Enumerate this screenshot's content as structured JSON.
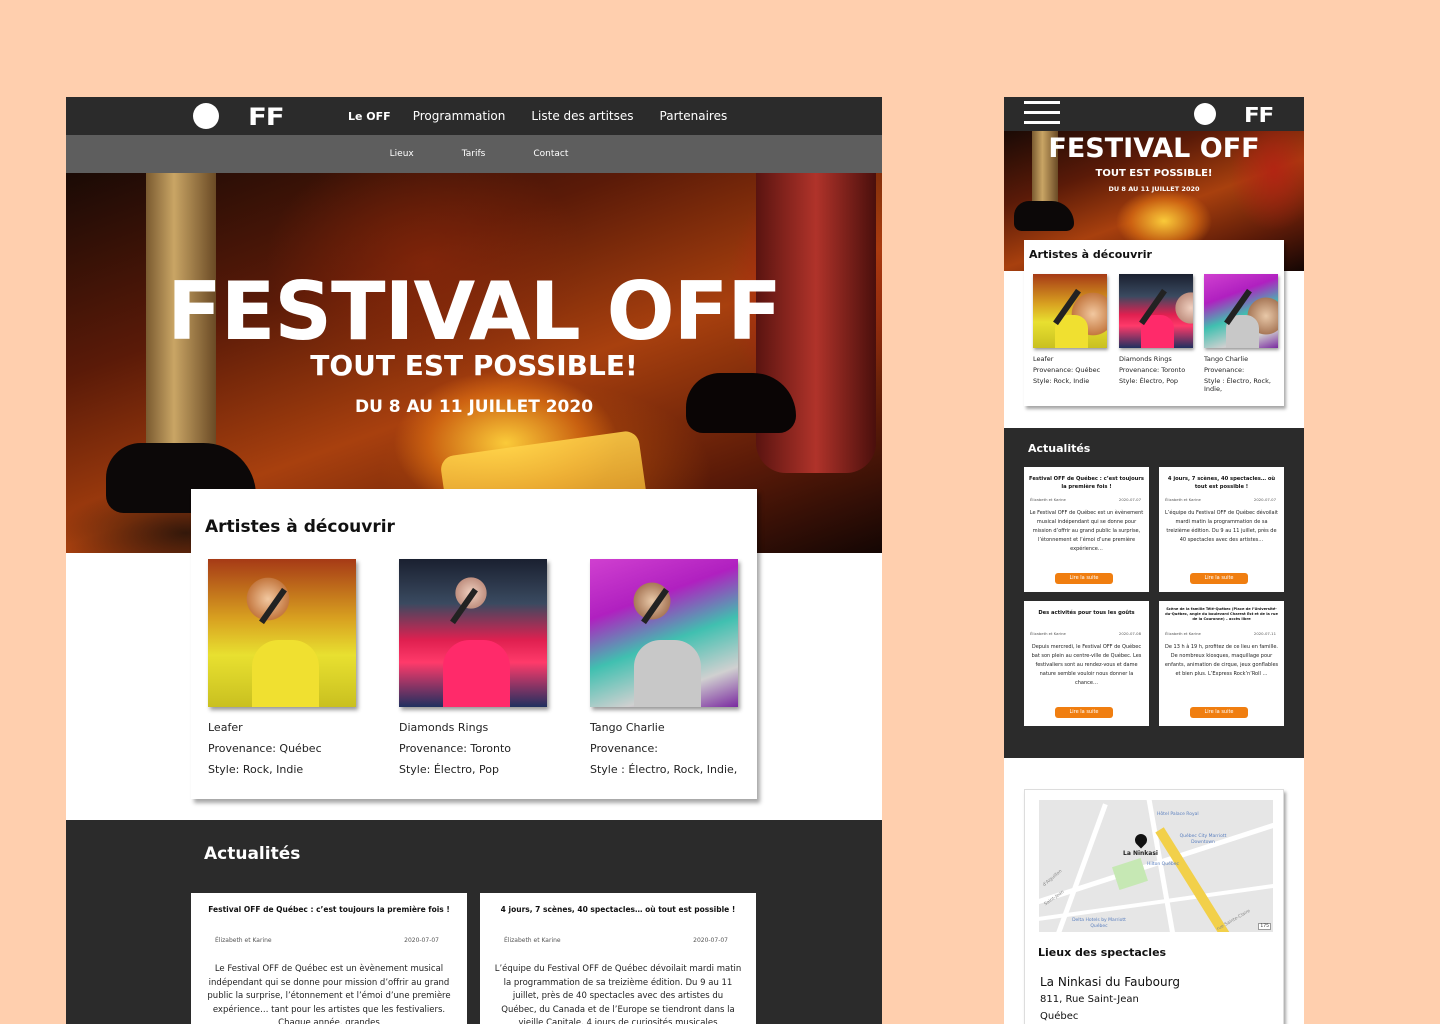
{
  "desktop": {
    "logo_text": "FF",
    "nav": {
      "items": [
        "Le OFF",
        "Programmation",
        "Liste des artitses",
        "Partenaires"
      ],
      "active": "Le OFF"
    },
    "subnav": [
      "Lieux",
      "Tarifs",
      "Contact"
    ],
    "hero": {
      "title": "FESTIVAL OFF",
      "tagline": "TOUT EST POSSIBLE!",
      "dates": "DU 8 AU 11 JUILLET 2020"
    },
    "artists": {
      "heading": "Artistes à découvrir",
      "items": [
        {
          "name": "Leafer",
          "provenance": "Provenance: Québec",
          "style": "Style: Rock, Indie"
        },
        {
          "name": "Diamonds Rings",
          "provenance": "Provenance: Toronto",
          "style": "Style: Électro, Pop"
        },
        {
          "name": "Tango Charlie",
          "provenance": "Provenance:",
          "style": "Style : Électro, Rock, Indie,"
        }
      ]
    },
    "news": {
      "heading": "Actualités",
      "cards": [
        {
          "title": "Festival OFF de Québec : c’est toujours la première fois !",
          "author": "Élizabeth et Karine",
          "date": "2020-07-07",
          "text": "Le Festival OFF de Québec est un èvènement musical indépendant qui se donne pour mission d’offrir au grand public la surprise, l’étonnement et l’émoi d’une première expérience… tant pour les artistes que les festivaliers. Chaque année, grandes"
        },
        {
          "title": "4 jours, 7 scènes, 40 spectacles… où tout est possible !",
          "author": "Élizabeth et Karine",
          "date": "2020-07-07",
          "text": "L’équipe du Festival OFF de Québec dévoilait mardi matin la programmation de sa treizième édition. Du 9 au 11 juillet, près de 40 spectacles avec des artistes du Québec, du Canada et de l’Europe se tiendront dans la vieille Capitale. 4 jours de curiosités musicales"
        }
      ]
    }
  },
  "mobile": {
    "logo_text": "FF",
    "hero": {
      "title": "FESTIVAL OFF",
      "tagline": "TOUT EST POSSIBLE!",
      "dates": "DU 8 AU 11 JUILLET 2020"
    },
    "artists": {
      "heading": "Artistes à découvrir",
      "items": [
        {
          "name": "Leafer",
          "provenance": "Provenance: Québec",
          "style": "Style: Rock, Indie"
        },
        {
          "name": "Diamonds Rings",
          "provenance": "Provenance: Toronto",
          "style": "Style: Électro, Pop"
        },
        {
          "name": "Tango Charlie",
          "provenance": "Provenance:",
          "style": "Style : Électro, Rock, Indie,"
        }
      ]
    },
    "news": {
      "heading": "Actualités",
      "button_label": "Lire la suite",
      "cards": [
        {
          "title": "Festival OFF de Québec : c’est toujours la première fois !",
          "author": "Élizabeth et Karine",
          "date": "2020-07-07",
          "text": "Le Festival OFF de Québec est un èvènement musical indépendant qui se donne pour mission d’offrir au grand public la surprise, l’étonnement et l’émoi d’une première expérience…"
        },
        {
          "title": "4 jours, 7 scènes, 40 spectacles… où tout est possible !",
          "author": "Élizabeth et Karine",
          "date": "2020-07-07",
          "text": "L’équipe du Festival OFF de Québec dévoilait mardi matin la programmation de sa treizième édition. Du 9 au 11 juillet, près de 40 spectacles avec des artistes…"
        },
        {
          "title": "Des activités pour tous les goûts",
          "author": "Élizabeth et Karine",
          "date": "2020-07-08",
          "text": "Depuis mercredi, le Festival OFF de Québec bat son plein au centre-ville de Québec. Les festivaliers sont au rendez-vous et dame nature semble vouloir nous donner la chance…"
        },
        {
          "title": "Scène de la famille Télé-Québec (Place de l’Université-du-Québec, angle du boulevard Charest Est et de la rue de la Couronne) – accès libre",
          "author": "Élizabeth et Karine",
          "date": "2020-07-11",
          "text": "De 13 h à 19 h, profitez de ce lieu en famille. De nombreux kiosques, maquillage pour enfants, animation de cirque, jeux gonflables et bien plus. L’Express Rock’n’Roll …"
        }
      ]
    },
    "venues": {
      "map": {
        "pin_label": "La Ninkasi",
        "labels": [
          "Hôtel Palace Royal",
          "Québec City Marriott Downtown",
          "Hilton Québec",
          "Delta Hotels by Marriott Québec",
          "Saint-Jean",
          "d'Aiguillon",
          "rue Sainte-Claire"
        ],
        "route_number": "175"
      },
      "heading": "Lieux des spectacles",
      "venue_name": "La Ninkasi du Faubourg",
      "address": "811, Rue Saint-Jean",
      "city": "Québec"
    }
  }
}
